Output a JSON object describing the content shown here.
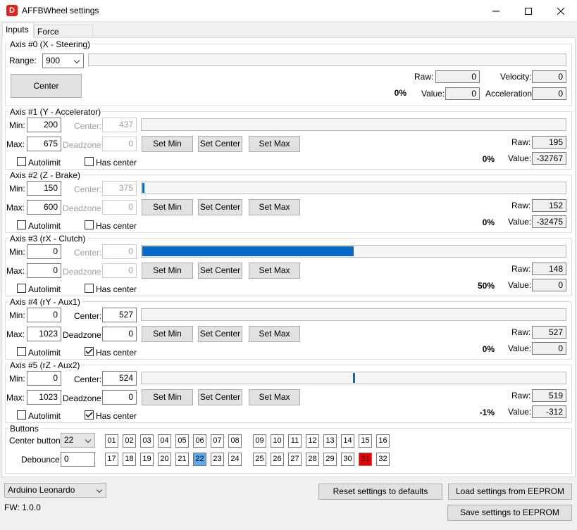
{
  "window": {
    "title": "AFFBWheel settings",
    "icon_letter": "D"
  },
  "tabs": [
    {
      "label": "Inputs"
    },
    {
      "label": "Force Feedback"
    }
  ],
  "axis0": {
    "title": "Axis #0 (X - Steering)",
    "range_label": "Range:",
    "range_value": "900",
    "center_button": "Center",
    "raw_label": "Raw:",
    "raw_value": "0",
    "value_label": "Value:",
    "value_value": "0",
    "velocity_label": "Velocity:",
    "velocity_value": "0",
    "acceleration_label": "Acceleration:",
    "acceleration_value": "0",
    "percent": "0%",
    "bar_fraction": 0
  },
  "labels": {
    "min": "Min:",
    "max": "Max:",
    "center": "Center:",
    "deadzone": "Deadzone:",
    "set_min": "Set Min",
    "set_center": "Set Center",
    "set_max": "Set Max",
    "autolimit": "Autolimit",
    "has_center": "Has center",
    "raw": "Raw:",
    "value": "Value:"
  },
  "axes": [
    {
      "title": "Axis #1 (Y - Accelerator)",
      "min": "200",
      "max": "675",
      "center": "437",
      "deadzone": "0",
      "raw": "195",
      "value": "-32767",
      "percent": "0%",
      "autolimit": false,
      "has_center": false,
      "bar_fraction": 0,
      "center_marker": false
    },
    {
      "title": "Axis #2 (Z - Brake)",
      "min": "150",
      "max": "600",
      "center": "375",
      "deadzone": "0",
      "raw": "152",
      "value": "-32475",
      "percent": "0%",
      "autolimit": false,
      "has_center": false,
      "bar_fraction": 0.005,
      "center_marker": false
    },
    {
      "title": "Axis #3 (rX - Clutch)",
      "min": "0",
      "max": "0",
      "center": "0",
      "deadzone": "0",
      "raw": "148",
      "value": "0",
      "percent": "50%",
      "autolimit": false,
      "has_center": false,
      "bar_fraction": 0.5,
      "center_marker": false
    },
    {
      "title": "Axis #4 (rY - Aux1)",
      "min": "0",
      "max": "1023",
      "center": "527",
      "deadzone": "0",
      "raw": "527",
      "value": "0",
      "percent": "0%",
      "autolimit": false,
      "has_center": true,
      "bar_fraction": 0,
      "center_marker": false
    },
    {
      "title": "Axis #5 (rZ - Aux2)",
      "min": "0",
      "max": "1023",
      "center": "524",
      "deadzone": "0",
      "raw": "519",
      "value": "-312",
      "percent": "-1%",
      "autolimit": false,
      "has_center": true,
      "bar_fraction": 0.5,
      "center_marker": true
    }
  ],
  "buttons": {
    "title": "Buttons",
    "center_button_label": "Center button:",
    "center_button_value": "22",
    "debounce_label": "Debounce:",
    "debounce_value": "0",
    "row1": [
      "01",
      "02",
      "03",
      "04",
      "05",
      "06",
      "07",
      "08",
      "09",
      "10",
      "11",
      "12",
      "13",
      "14",
      "15",
      "16"
    ],
    "row2": [
      "17",
      "18",
      "19",
      "20",
      "21",
      "22",
      "23",
      "24",
      "25",
      "26",
      "27",
      "28",
      "29",
      "30",
      "31",
      "32"
    ],
    "highlight_blue": "22",
    "highlight_red": "31",
    "colors": {
      "blue": "#5aabf4",
      "red": "#e80000"
    }
  },
  "footer": {
    "device": "Arduino Leonardo",
    "fw": "FW: 1.0.0",
    "reset": "Reset settings to defaults",
    "load": "Load settings from EEPROM",
    "save": "Save settings to EEPROM"
  }
}
